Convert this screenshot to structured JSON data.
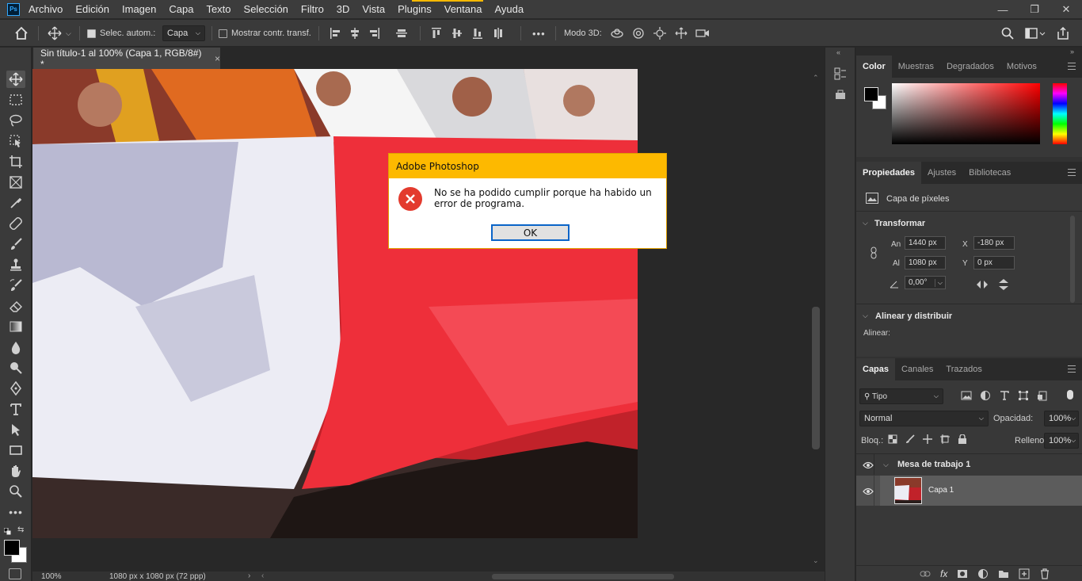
{
  "app": {
    "logo": "Ps"
  },
  "menu": [
    "Archivo",
    "Edición",
    "Imagen",
    "Capa",
    "Texto",
    "Selección",
    "Filtro",
    "3D",
    "Vista",
    "Plugins",
    "Ventana",
    "Ayuda"
  ],
  "window_controls": {
    "minimize": "—",
    "restore": "❐",
    "close": "✕"
  },
  "options": {
    "auto_select_label": "Selec. autom.:",
    "auto_select_value": "Capa",
    "show_transform_label": "Mostrar contr. transf.",
    "mode3d_label": "Modo 3D:",
    "more": "•••"
  },
  "document_tab": {
    "title": "Sin título-1 al 100% (Capa 1, RGB/8#) *",
    "close": "×"
  },
  "status": {
    "zoom": "100%",
    "info": "1080 px x 1080 px (72 ppp)"
  },
  "dialog": {
    "title": "Adobe Photoshop",
    "message": "No se ha podido cumplir porque ha habido un error de programa.",
    "ok": "OK"
  },
  "color_panel": {
    "tabs": [
      "Color",
      "Muestras",
      "Degradados",
      "Motivos"
    ]
  },
  "properties_panel": {
    "tabs": [
      "Propiedades",
      "Ajustes",
      "Bibliotecas"
    ],
    "layer_type": "Capa de píxeles",
    "transform": {
      "title": "Transformar",
      "w_label": "An",
      "w": "1440 px",
      "h_label": "Al",
      "h": "1080 px",
      "x_label": "X",
      "x": "-180 px",
      "y_label": "Y",
      "y": "0 px",
      "angle": "0,00°"
    },
    "align": {
      "title": "Alinear y distribuir",
      "label": "Alinear:"
    }
  },
  "layers_panel": {
    "tabs": [
      "Capas",
      "Canales",
      "Trazados"
    ],
    "filter": "Tipo",
    "blend_mode": "Normal",
    "opacity_label": "Opacidad:",
    "opacity": "100%",
    "lock_label": "Bloq.:",
    "fill_label": "Relleno:",
    "fill": "100%",
    "artboard": "Mesa de trabajo 1",
    "layer": "Capa 1"
  }
}
